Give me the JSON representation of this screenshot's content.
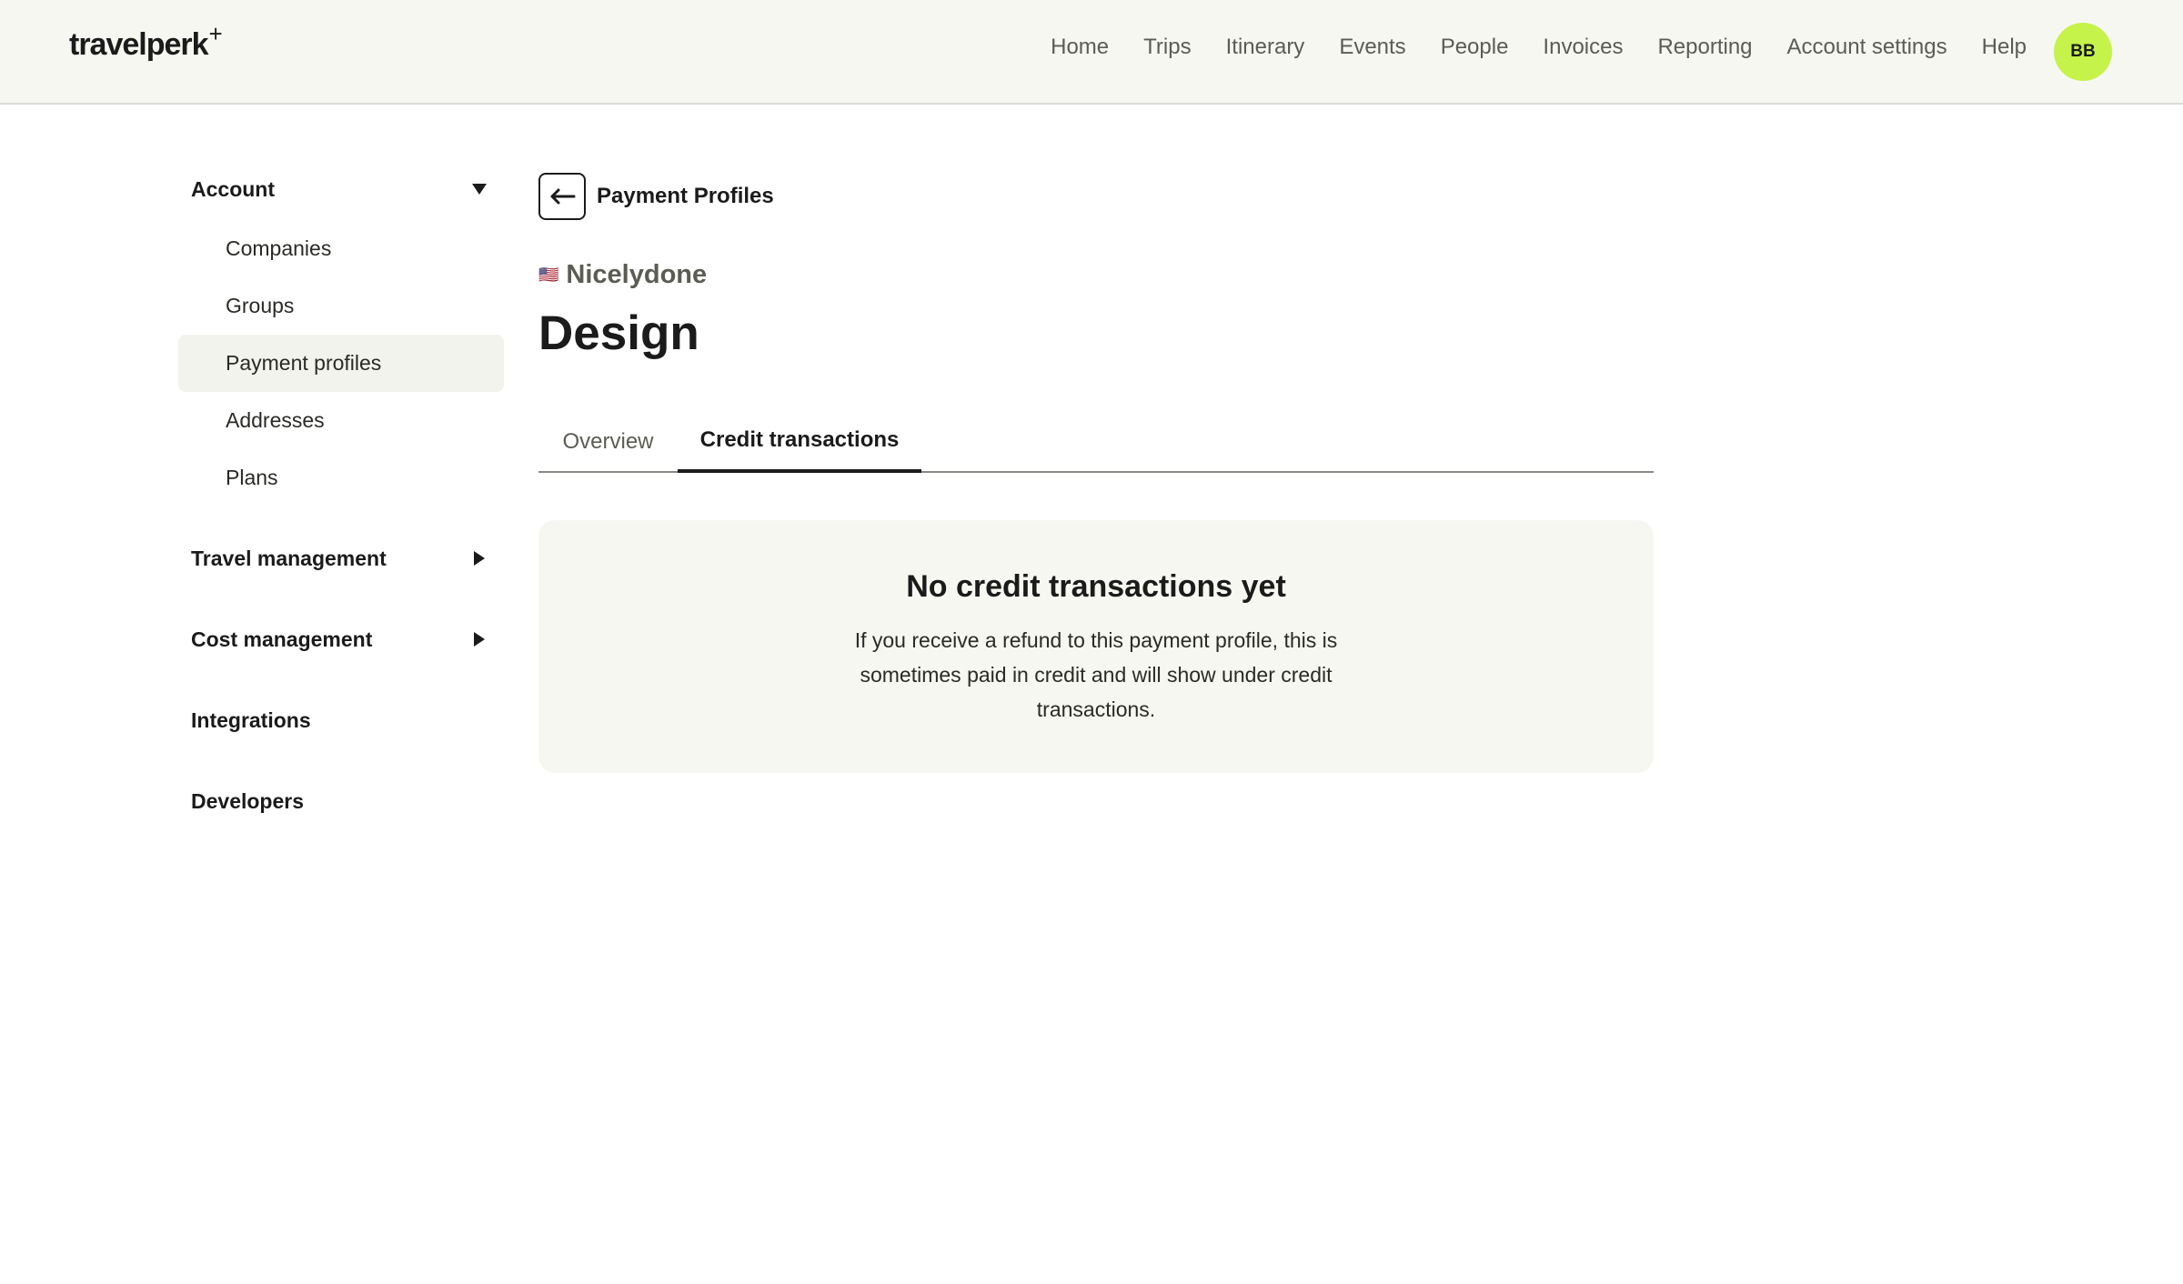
{
  "header": {
    "logo": "travelperk",
    "logo_mark": "+",
    "nav": [
      "Home",
      "Trips",
      "Itinerary",
      "Events",
      "People",
      "Invoices",
      "Reporting",
      "Account settings",
      "Help"
    ],
    "avatar_initials": "BB",
    "avatar_color": "#c5f34a"
  },
  "sidebar": {
    "account": {
      "label": "Account",
      "expanded": true,
      "items": [
        "Companies",
        "Groups",
        "Payment profiles",
        "Addresses",
        "Plans"
      ],
      "active": "Payment profiles"
    },
    "travel_management": "Travel management",
    "cost_management": "Cost management",
    "integrations": "Integrations",
    "developers": "Developers"
  },
  "main": {
    "back_label": "Payment Profiles",
    "company_flag": "🇺🇸",
    "company_name": "Nicelydone",
    "title": "Design",
    "tabs": [
      "Overview",
      "Credit transactions"
    ],
    "active_tab": "Credit transactions",
    "empty_state": {
      "title": "No credit transactions yet",
      "body": "If you receive a refund to this payment profile, this is sometimes paid in credit and will show under credit transactions."
    }
  },
  "icons": {
    "back": "arrow-left-icon",
    "expand": "caret-down-icon",
    "collapsed": "caret-right-icon"
  }
}
